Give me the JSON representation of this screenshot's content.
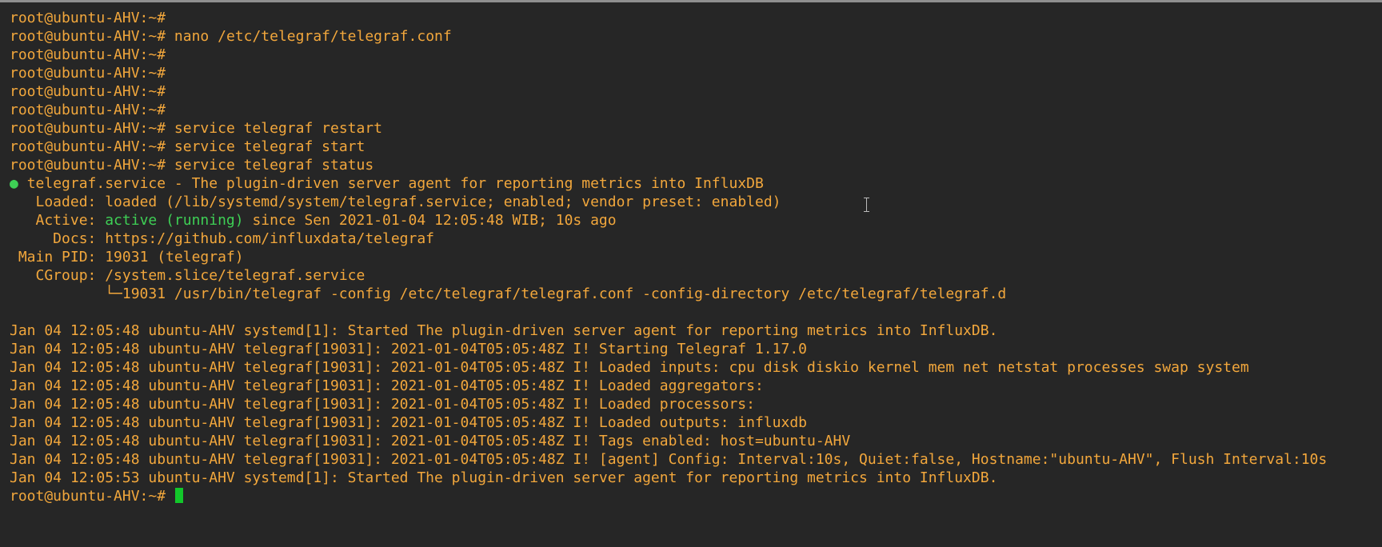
{
  "terminal": {
    "prompt": "root@ubuntu-AHV:~#",
    "history": [
      {
        "command": ""
      },
      {
        "command": "nano /etc/telegraf/telegraf.conf"
      },
      {
        "command": ""
      },
      {
        "command": ""
      },
      {
        "command": ""
      },
      {
        "command": ""
      },
      {
        "command": "service telegraf restart"
      },
      {
        "command": "service telegraf start"
      },
      {
        "command": "service telegraf status"
      }
    ],
    "status": {
      "bullet": "●",
      "service_line": "telegraf.service - The plugin-driven server agent for reporting metrics into InfluxDB",
      "loaded_label": "   Loaded: ",
      "loaded_value": "loaded (/lib/systemd/system/telegraf.service; enabled; vendor preset: enabled)",
      "active_label": "   Active: ",
      "active_state": "active (running)",
      "active_rest": " since Sen 2021-01-04 12:05:48 WIB; 10s ago",
      "docs_label": "     Docs: ",
      "docs_value": "https://github.com/influxdata/telegraf",
      "pid_label": " Main PID: ",
      "pid_value": "19031 (telegraf)",
      "cgroup_label": "   CGroup: ",
      "cgroup_value": "/system.slice/telegraf.service",
      "cgroup_child": "           └─19031 /usr/bin/telegraf -config /etc/telegraf/telegraf.conf -config-directory /etc/telegraf/telegraf.d"
    },
    "logs": [
      "Jan 04 12:05:48 ubuntu-AHV systemd[1]: Started The plugin-driven server agent for reporting metrics into InfluxDB.",
      "Jan 04 12:05:48 ubuntu-AHV telegraf[19031]: 2021-01-04T05:05:48Z I! Starting Telegraf 1.17.0",
      "Jan 04 12:05:48 ubuntu-AHV telegraf[19031]: 2021-01-04T05:05:48Z I! Loaded inputs: cpu disk diskio kernel mem net netstat processes swap system",
      "Jan 04 12:05:48 ubuntu-AHV telegraf[19031]: 2021-01-04T05:05:48Z I! Loaded aggregators:",
      "Jan 04 12:05:48 ubuntu-AHV telegraf[19031]: 2021-01-04T05:05:48Z I! Loaded processors:",
      "Jan 04 12:05:48 ubuntu-AHV telegraf[19031]: 2021-01-04T05:05:48Z I! Loaded outputs: influxdb",
      "Jan 04 12:05:48 ubuntu-AHV telegraf[19031]: 2021-01-04T05:05:48Z I! Tags enabled: host=ubuntu-AHV",
      "Jan 04 12:05:48 ubuntu-AHV telegraf[19031]: 2021-01-04T05:05:48Z I! [agent] Config: Interval:10s, Quiet:false, Hostname:\"ubuntu-AHV\", Flush Interval:10s",
      "Jan 04 12:05:53 ubuntu-AHV systemd[1]: Started The plugin-driven server agent for reporting metrics into InfluxDB."
    ]
  },
  "colors": {
    "background": "#262626",
    "prompt": "#f2a73c",
    "active_green": "#3ecf55",
    "cursor": "#12c72a"
  },
  "icons": {
    "mouse_pointer": "i-beam-cursor-icon",
    "text_cursor": "block-cursor-icon"
  }
}
